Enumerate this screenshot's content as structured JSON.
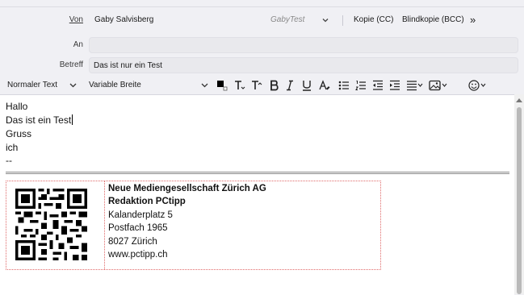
{
  "header": {
    "from_label": "Von",
    "from_name": "Gaby Salvisberg",
    "identity": "GabyTest",
    "cc_label": "Kopie (CC)",
    "bcc_label": "Blindkopie (BCC)",
    "more": "»",
    "to_label": "An",
    "to_value": "",
    "subject_label": "Betreff",
    "subject_value": "Das ist nur ein Test"
  },
  "toolbar": {
    "paragraph_format": "Normaler Text",
    "font": "Variable Breite",
    "buttons": [
      {
        "icon": "text-color-icon"
      },
      {
        "icon": "font-size-smaller-icon"
      },
      {
        "icon": "font-size-larger-icon"
      },
      {
        "icon": "bold-icon"
      },
      {
        "icon": "italic-icon"
      },
      {
        "icon": "underline-icon"
      },
      {
        "icon": "clear-formatting-icon"
      },
      {
        "icon": "bullet-list-icon"
      },
      {
        "icon": "numbered-list-icon"
      },
      {
        "icon": "decrease-indent-icon"
      },
      {
        "icon": "increase-indent-icon"
      },
      {
        "icon": "align-icon"
      },
      {
        "icon": "insert-image-icon"
      },
      {
        "icon": "emoji-icon"
      }
    ]
  },
  "body": {
    "lines": [
      "Hallo",
      "Das ist ein Test",
      "Gruss",
      "ich",
      "--"
    ]
  },
  "signature": {
    "company": "Neue Mediengesellschaft Zürich AG",
    "department": "Redaktion PCtipp",
    "street": "Kalanderplatz 5",
    "pobox": "Postfach 1965",
    "city": "8027 Zürich",
    "web": "www.pctipp.ch"
  }
}
